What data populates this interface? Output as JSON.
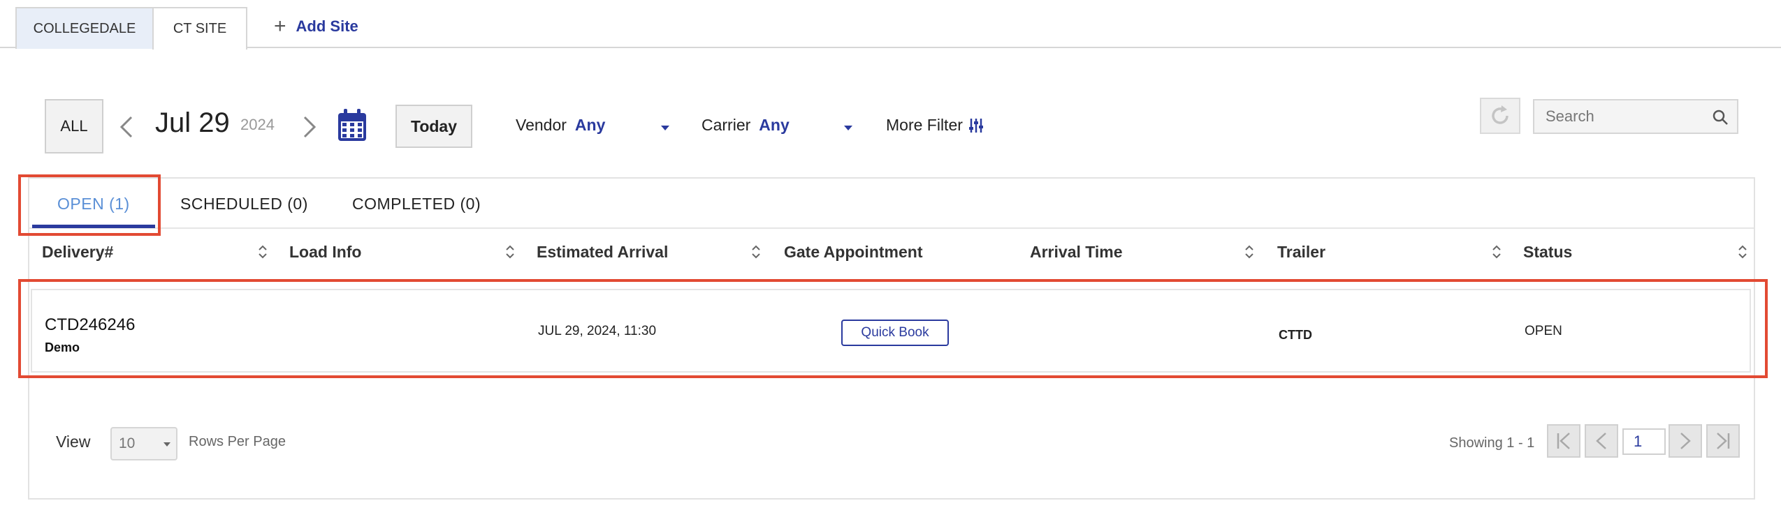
{
  "site_tabs": [
    {
      "label": "COLLEGEDALE"
    },
    {
      "label": "CT SITE"
    }
  ],
  "add_site_label": "Add Site",
  "toolbar": {
    "all_label": "ALL",
    "date": "Jul 29",
    "year": "2024",
    "today_label": "Today",
    "vendor_label": "Vendor",
    "vendor_value": "Any",
    "carrier_label": "Carrier",
    "carrier_value": "Any",
    "more_filter_label": "More Filter",
    "search_placeholder": "Search"
  },
  "status_tabs": [
    {
      "label": "OPEN (1)",
      "active": true
    },
    {
      "label": "SCHEDULED (0)",
      "active": false
    },
    {
      "label": "COMPLETED (0)",
      "active": false
    }
  ],
  "columns": [
    "Delivery#",
    "Load Info",
    "Estimated Arrival",
    "Gate Appointment",
    "Arrival Time",
    "Trailer",
    "Status"
  ],
  "rows": [
    {
      "delivery": "CTD246246",
      "delivery_sub": "Demo",
      "load_info": "",
      "estimated_arrival": "JUL 29, 2024, 11:30",
      "gate_appointment_button": "Quick Book",
      "arrival_time": "",
      "trailer": "CTTD",
      "status": "OPEN"
    }
  ],
  "footer": {
    "view_label": "View",
    "rows_per_page_value": "10",
    "rows_per_page_label": "Rows Per Page",
    "showing": "Showing 1 - 1",
    "page": "1"
  },
  "colors": {
    "accent": "#2a3a9e",
    "active_tab_text": "#5a8fd6",
    "highlight": "#e24a33"
  }
}
